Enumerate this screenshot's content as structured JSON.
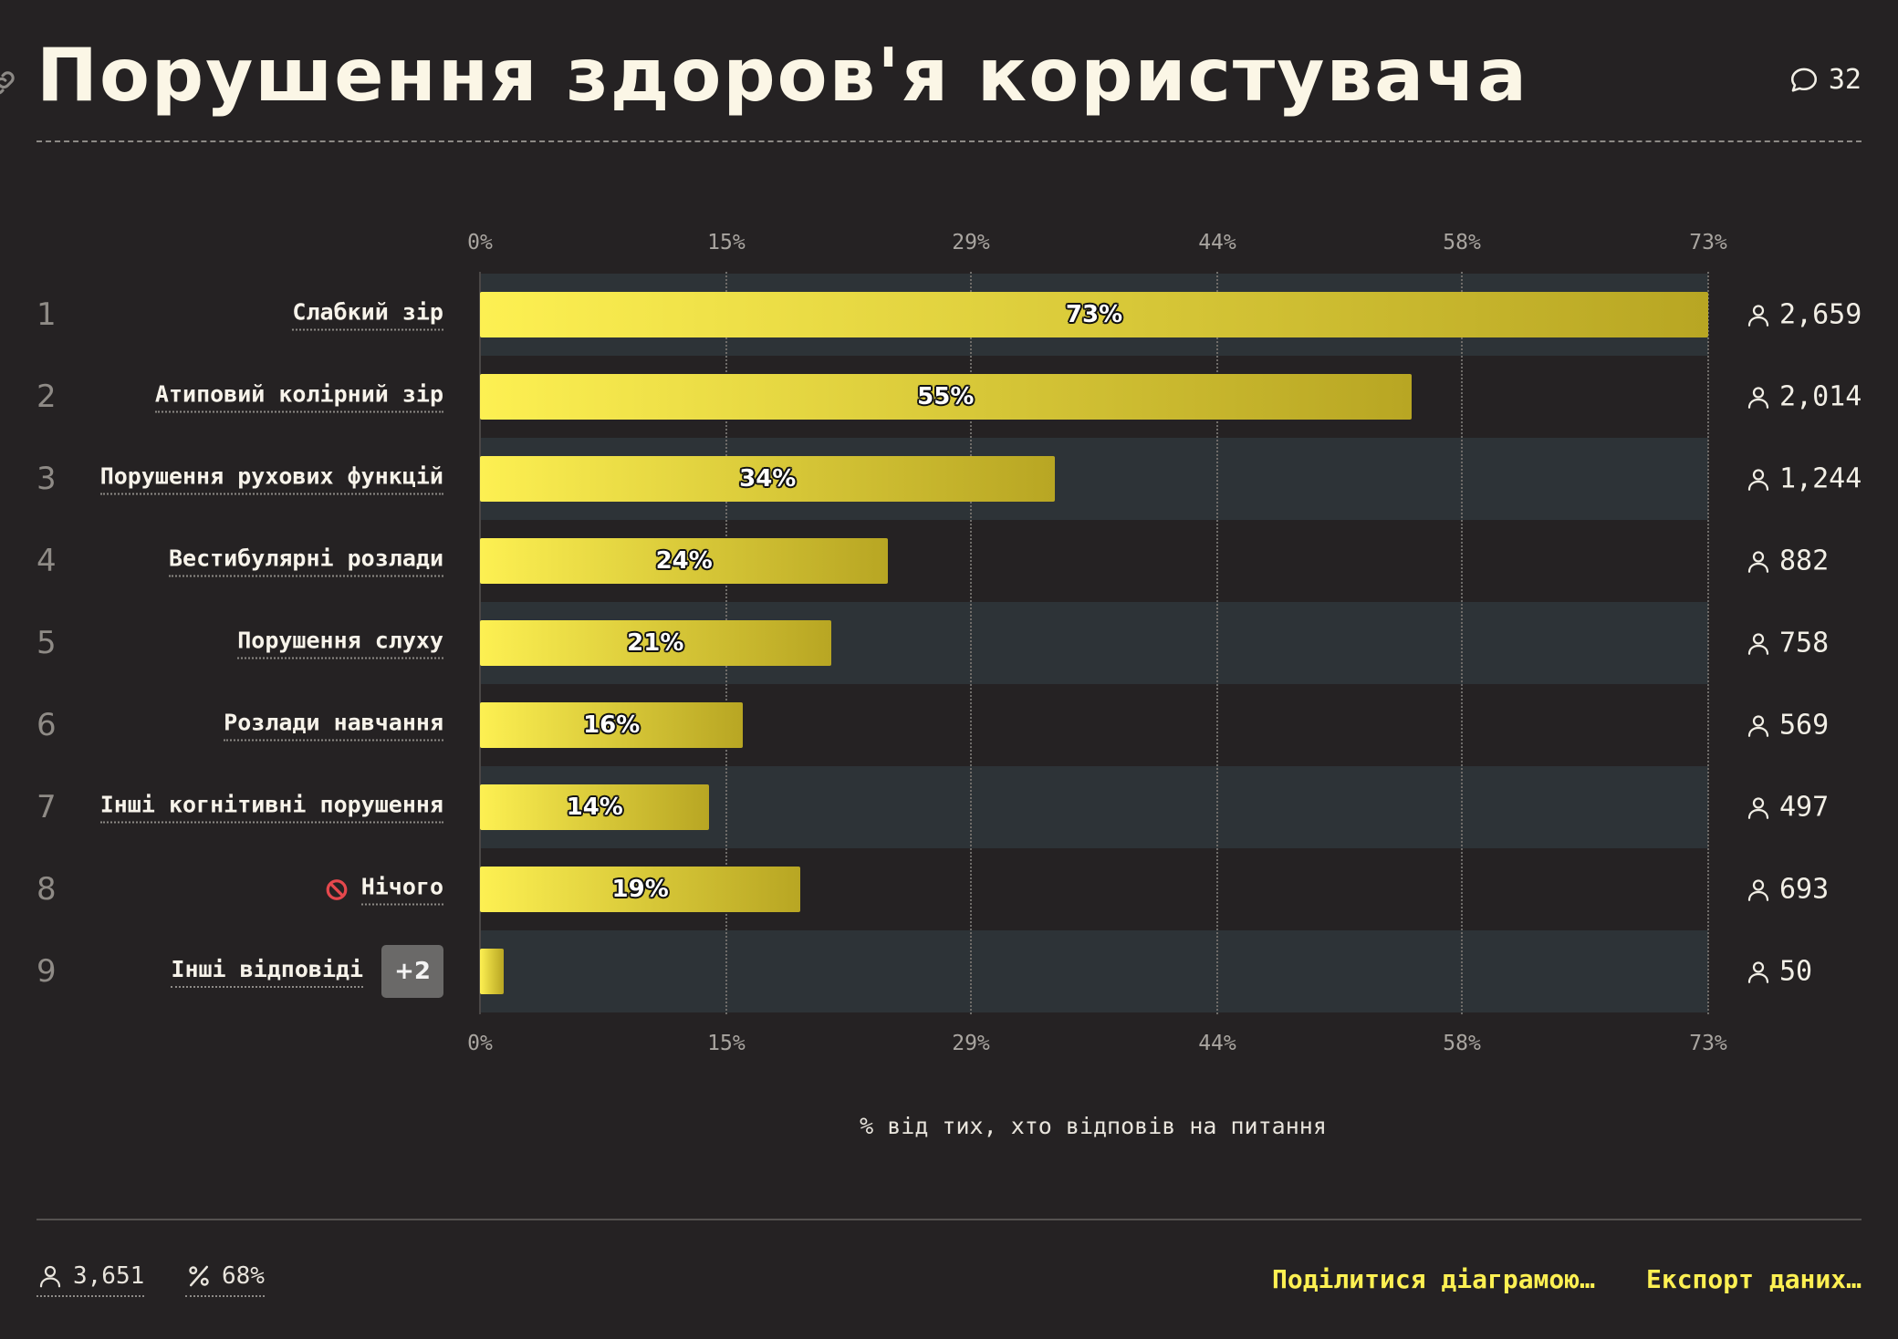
{
  "header": {
    "title": "Порушення здоров'я користувача",
    "comment_count": "32"
  },
  "chart_data": {
    "type": "bar",
    "orientation": "horizontal",
    "xlabel": "% від тих, хто відповів на питання",
    "ticks": [
      "0%",
      "15%",
      "29%",
      "44%",
      "58%",
      "73%"
    ],
    "tick_values": [
      0,
      14.6,
      29.1,
      43.7,
      58.2,
      72.8
    ],
    "xlim": [
      0,
      72.8
    ],
    "categories": [
      "Слабкий зір",
      "Атиповий колірний зір",
      "Порушення рухових функцій",
      "Вестибулярні розлади",
      "Порушення слуху",
      "Розлади навчання",
      "Інші когнітивні порушення",
      "Нічого",
      "Інші відповіді"
    ],
    "ranks": [
      "1",
      "2",
      "3",
      "4",
      "5",
      "6",
      "7",
      "8",
      "9"
    ],
    "values": [
      72.8,
      55.2,
      34.1,
      24.2,
      20.8,
      15.6,
      13.6,
      19.0,
      1.4
    ],
    "value_labels": [
      "73%",
      "55%",
      "34%",
      "24%",
      "21%",
      "16%",
      "14%",
      "19%",
      ""
    ],
    "counts": [
      "2,659",
      "2,014",
      "1,244",
      "882",
      "758",
      "569",
      "497",
      "693",
      "50"
    ],
    "other_badge": "+2",
    "grid": true,
    "colors": {
      "bar_start": "#fdf052",
      "bar_end": "#b8a623",
      "band": "#2d3337",
      "background": "#252223"
    }
  },
  "footer": {
    "respondents": "3,651",
    "response_rate": "68%",
    "share_label": "Поділитися діаграмою…",
    "export_label": "Експорт даних…"
  }
}
